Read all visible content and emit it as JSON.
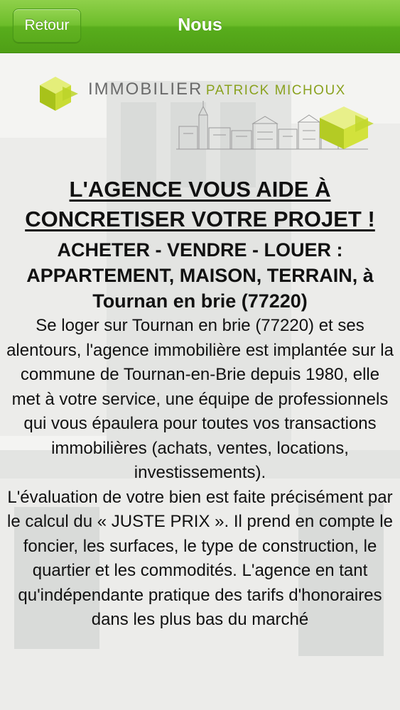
{
  "nav": {
    "back_label": "Retour",
    "title": "Nous"
  },
  "logo": {
    "word1": "IMMOBILIER",
    "word2": "PATRICK MICHOUX",
    "accent_color": "#c8dc2a"
  },
  "content": {
    "headline": "L'AGENCE VOUS AIDE À CONCRETISER VOTRE PROJET !",
    "subhead": "ACHETER - VENDRE - LOUER : APPARTEMENT, MAISON, TERRAIN, à Tournan en brie (77220)",
    "paragraph_1": "Se loger sur Tournan en brie (77220) et ses alentours, l'agence immobilière est implantée sur la commune de Tournan-en-Brie depuis 1980, elle met à votre service, une équipe de professionnels qui vous épaulera pour toutes vos transactions immobilières (achats, ventes, locations, investissements).",
    "paragraph_2": "L'évaluation de votre bien est faite précisément par le calcul du « JUSTE PRIX ». Il prend en compte le foncier, les surfaces, le type de construction, le quartier et les commodités. L'agence en tant qu'indépendante pratique des tarifs d'honoraires dans les plus bas du marché"
  },
  "colors": {
    "header_green": "#6cbd2a",
    "text": "#111111"
  }
}
